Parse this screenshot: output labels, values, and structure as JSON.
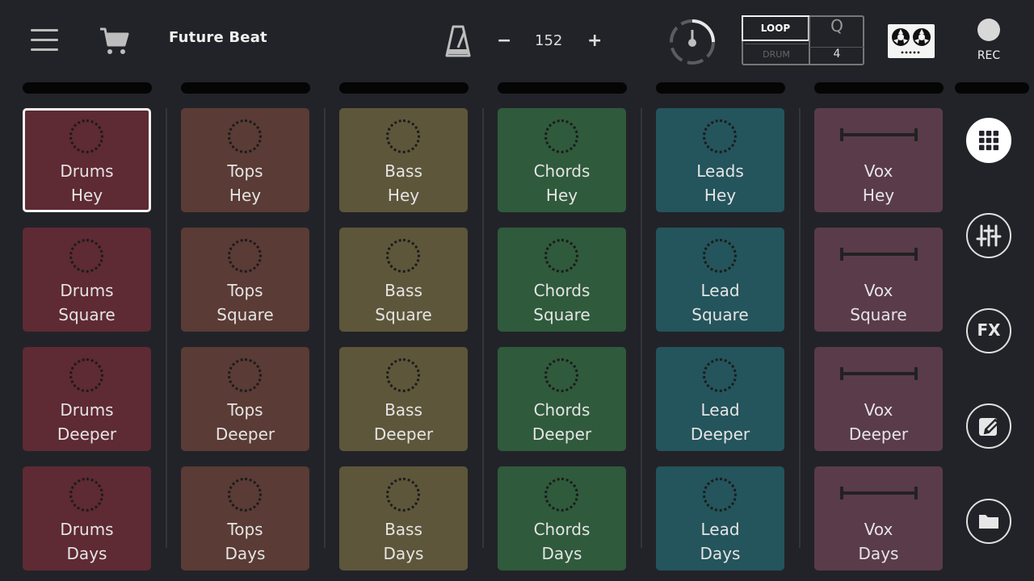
{
  "app": {
    "title": "Future Beat"
  },
  "tempo": {
    "minus": "−",
    "value": "152",
    "plus": "+"
  },
  "modes": {
    "loop": "LOOP",
    "drum": "DRUM",
    "q_label": "Q",
    "q_value": "4"
  },
  "record": {
    "label": "REC"
  },
  "colors": {
    "background": "#222328",
    "drums": "#5e2a33",
    "tops": "#5a3b35",
    "bass": "#5e563a",
    "chords": "#2f5a3c",
    "leads": "#24545c",
    "vox": "#5a3b4a"
  },
  "columns": [
    {
      "id": "drums",
      "pads": [
        {
          "name": "Drums",
          "variant": "Hey"
        },
        {
          "name": "Drums",
          "variant": "Square"
        },
        {
          "name": "Drums",
          "variant": "Deeper"
        },
        {
          "name": "Drums",
          "variant": "Days"
        }
      ]
    },
    {
      "id": "tops",
      "pads": [
        {
          "name": "Tops",
          "variant": "Hey"
        },
        {
          "name": "Tops",
          "variant": "Square"
        },
        {
          "name": "Tops",
          "variant": "Deeper"
        },
        {
          "name": "Tops",
          "variant": "Days"
        }
      ]
    },
    {
      "id": "bass",
      "pads": [
        {
          "name": "Bass",
          "variant": "Hey"
        },
        {
          "name": "Bass",
          "variant": "Square"
        },
        {
          "name": "Bass",
          "variant": "Deeper"
        },
        {
          "name": "Bass",
          "variant": "Days"
        }
      ]
    },
    {
      "id": "chords",
      "pads": [
        {
          "name": "Chords",
          "variant": "Hey"
        },
        {
          "name": "Chords",
          "variant": "Square"
        },
        {
          "name": "Chords",
          "variant": "Deeper"
        },
        {
          "name": "Chords",
          "variant": "Days"
        }
      ]
    },
    {
      "id": "leads",
      "pads": [
        {
          "name": "Leads",
          "variant": "Hey"
        },
        {
          "name": "Lead",
          "variant": "Square"
        },
        {
          "name": "Lead",
          "variant": "Deeper"
        },
        {
          "name": "Lead",
          "variant": "Days"
        }
      ]
    },
    {
      "id": "vox",
      "pads": [
        {
          "name": "Vox",
          "variant": "Hey"
        },
        {
          "name": "Vox",
          "variant": "Square"
        },
        {
          "name": "Vox",
          "variant": "Deeper"
        },
        {
          "name": "Vox",
          "variant": "Days"
        }
      ]
    }
  ],
  "side": {
    "fx_label": "FX"
  },
  "icons": [
    "menu-icon",
    "cart-icon",
    "metronome-icon",
    "timer-dial-icon",
    "cassette-icon",
    "grid-icon",
    "mixer-icon",
    "edit-icon",
    "folder-icon"
  ]
}
